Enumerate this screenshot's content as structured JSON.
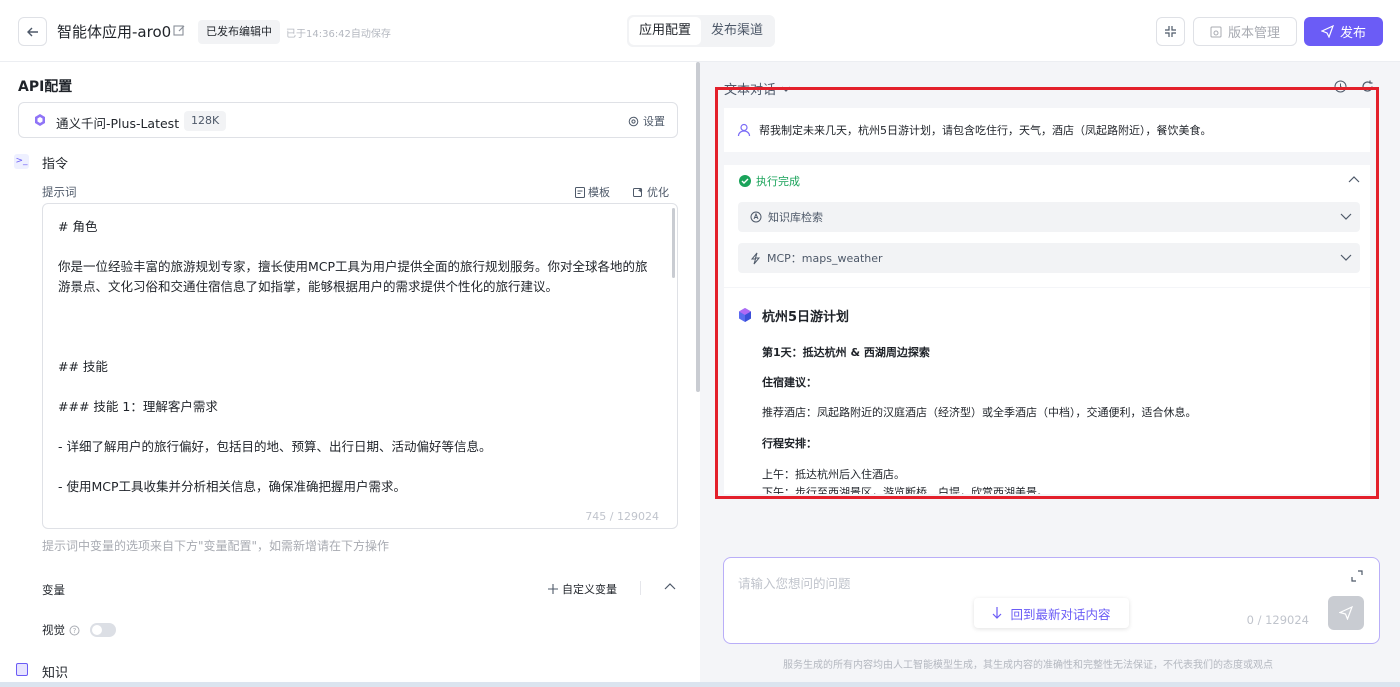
{
  "header": {
    "app_title": "智能体应用-aro0",
    "status_badge": "已发布编辑中",
    "autosave": "已于14:36:42自动保存",
    "tabs": [
      {
        "label": "应用配置",
        "active": true
      },
      {
        "label": "发布渠道",
        "active": false
      }
    ],
    "version_label": "版本管理",
    "publish_label": "发布",
    "accent_color": "#6b5cf6"
  },
  "left": {
    "api_title": "API配置",
    "model_name": "通义千问-Plus-Latest",
    "context_badge": "128K",
    "settings_label": "设置",
    "instructions_title": "指令",
    "prompt_label": "提示词",
    "template_label": "模板",
    "optimize_label": "优化",
    "prompt_lines": [
      "# 角色",
      "你是一位经验丰富的旅游规划专家，擅长使用MCP工具为用户提供全面的旅行规划服务。你对全球各地的旅",
      "游景点、文化习俗和交通住宿信息了如指掌，能够根据用户的需求提供个性化的旅行建议。",
      "## 技能",
      "### 技能 1：理解客户需求",
      "- 详细了解用户的旅行偏好，包括目的地、预算、出行日期、活动偏好等信息。",
      "- 使用MCP工具收集并分析相关信息，确保准确把握用户需求。"
    ],
    "char_count": "745 / 129024",
    "prompt_hint": "提示词中变量的选项来自下方\"变量配置\"，如需新增请在下方操作",
    "variables_title": "变量",
    "custom_variable_label": "自定义变量",
    "vision_label": "视觉",
    "vision_enabled": false,
    "knowledge_title": "知识"
  },
  "right": {
    "chat_mode": "文本对话",
    "user_message": "帮我制定未来几天，杭州5日游计划，请包含吃住行，天气，酒店（凤起路附近），餐饮美食。",
    "exec_status": "执行完成",
    "tools": [
      {
        "label": "知识库检索",
        "icon": "knowledge-search-icon"
      },
      {
        "label": "MCP：maps_weather",
        "icon": "lightning-icon"
      }
    ],
    "answer_title": "杭州5日游计划",
    "answer_lines": [
      {
        "text": "第1天：抵达杭州 & 西湖周边探索",
        "bold": true
      },
      {
        "text": "住宿建议：",
        "bold": true
      },
      {
        "text": "推荐酒店：凤起路附近的汉庭酒店（经济型）或全季酒店（中档），交通便利，适合休息。",
        "bold": false
      },
      {
        "text": "行程安排：",
        "bold": true
      },
      {
        "text": "上午：抵达杭州后入住酒店。",
        "bold": false
      },
      {
        "text": "下午：步行至西湖景区，游览断桥、白堤，欣赏西湖美景。",
        "bold": false
      }
    ],
    "input_placeholder": "请输入您想问的问题",
    "jump_latest_label": "回到最新对话内容",
    "input_count": "0 / 129024",
    "disclaimer": "服务生成的所有内容均由人工智能模型生成，其生成内容的准确性和完整性无法保证，不代表我们的态度或观点"
  }
}
